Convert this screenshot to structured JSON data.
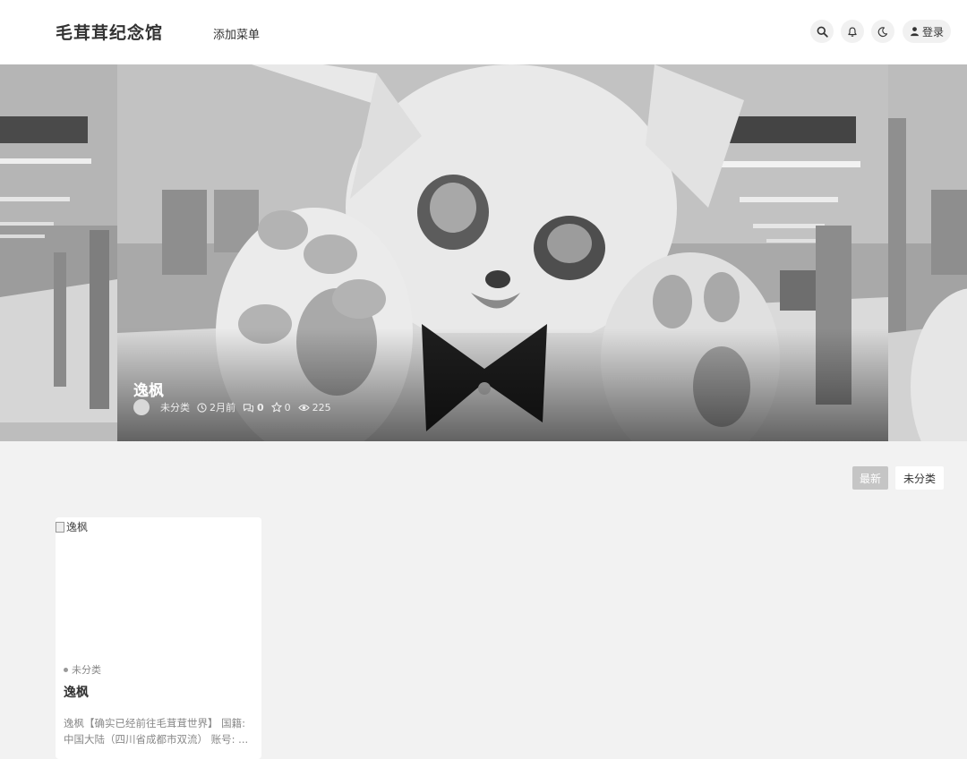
{
  "header": {
    "site_title": "毛茸茸纪念馆",
    "nav": [
      {
        "label": "添加菜单"
      }
    ],
    "login_label": "登录",
    "icons": [
      "search-icon",
      "bell-icon",
      "moon-icon",
      "user-icon"
    ]
  },
  "hero": {
    "title": "逸枫",
    "category": "未分类",
    "time_ago": "2月前",
    "comments": "0",
    "likes": "0",
    "views": "225",
    "icons": [
      "clock-icon",
      "comment-icon",
      "star-icon",
      "eye-icon"
    ]
  },
  "filters": {
    "items": [
      {
        "label": "最新",
        "active": true
      },
      {
        "label": "未分类",
        "active": false
      }
    ]
  },
  "posts": [
    {
      "image_alt": "逸枫",
      "category": "未分类",
      "title": "逸枫",
      "excerpt": "逸枫【确实已经前往毛茸茸世界】 国籍: 中国大陆（四川省成都市双流） 账号: ..."
    }
  ],
  "colors": {
    "header_bg": "#ffffff",
    "page_bg": "#f2f2f2",
    "active_filter_bg": "#c5c5c5"
  }
}
